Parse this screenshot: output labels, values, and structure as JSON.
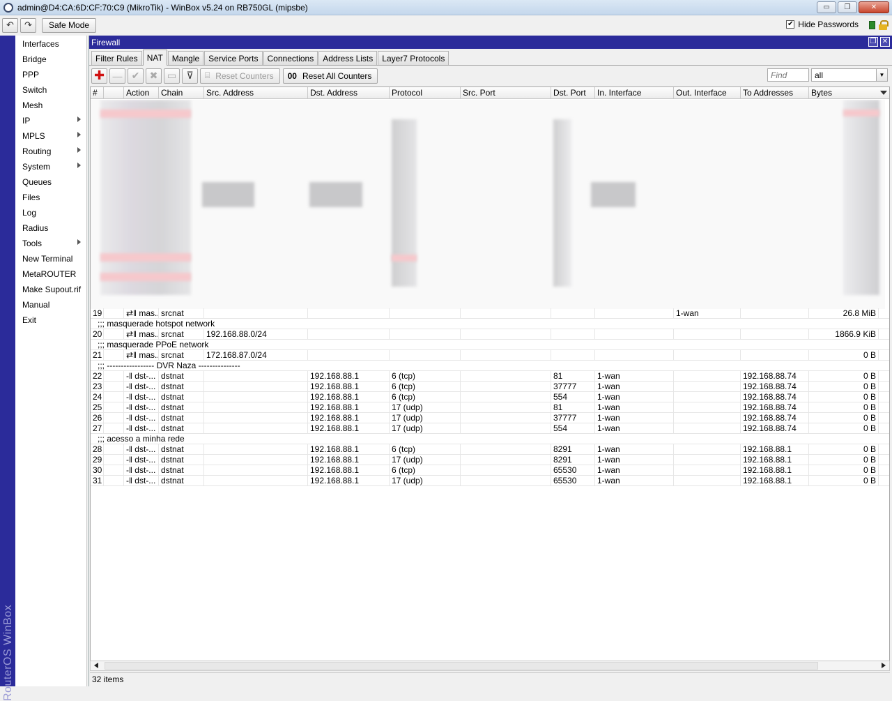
{
  "window": {
    "title": "admin@D4:CA:6D:CF:70:C9 (MikroTik) - WinBox v5.24 on RB750GL (mipsbe)",
    "controls": [
      "▭",
      "❐",
      "✕"
    ]
  },
  "toolbar": {
    "undo_icon": "↶",
    "redo_icon": "↷",
    "safe_mode_label": "Safe Mode",
    "hide_passwords_label": "Hide Passwords",
    "hide_passwords_checked": "✔"
  },
  "sidebar": {
    "brand": "RouterOS WinBox",
    "items": [
      {
        "label": "Interfaces"
      },
      {
        "label": "Bridge"
      },
      {
        "label": "PPP"
      },
      {
        "label": "Switch"
      },
      {
        "label": "Mesh"
      },
      {
        "label": "IP"
      },
      {
        "label": "MPLS"
      },
      {
        "label": "Routing"
      },
      {
        "label": "System"
      },
      {
        "label": "Queues"
      },
      {
        "label": "Files"
      },
      {
        "label": "Log"
      },
      {
        "label": "Radius"
      },
      {
        "label": "Tools"
      },
      {
        "label": "New Terminal"
      },
      {
        "label": "MetaROUTER"
      },
      {
        "label": "Make Supout.rif"
      },
      {
        "label": "Manual"
      },
      {
        "label": "Exit"
      }
    ]
  },
  "firewall": {
    "title": "Firewall",
    "tabs": [
      "Filter Rules",
      "NAT",
      "Mangle",
      "Service Ports",
      "Connections",
      "Address Lists",
      "Layer7 Protocols"
    ],
    "active_tab": "NAT",
    "buttons": {
      "add_icon": "✚",
      "remove_icon": "—",
      "enable_icon": "✔",
      "disable_icon": "✖",
      "comment_icon": "▭",
      "filter_icon": "⊽",
      "reset_counters": "Reset Counters",
      "reset_all_counters": "Reset All Counters",
      "reset_all_icon": "00"
    },
    "find_placeholder": "Find",
    "filter_value": "all",
    "columns": [
      "#",
      "",
      "Action",
      "Chain",
      "Src. Address",
      "Dst. Address",
      "Protocol",
      "Src. Port",
      "Dst. Port",
      "In. Interface",
      "Out. Interface",
      "To Addresses",
      "Bytes"
    ],
    "rows": [
      {
        "type": "rule",
        "num": "19",
        "action": "⇄‖ mas...",
        "chain": "srcnat",
        "src": "",
        "dst": "",
        "proto": "",
        "sport": "",
        "dport": "",
        "inif": "",
        "outif": "1-wan",
        "to": "",
        "bytes": "26.8 MiB"
      },
      {
        "type": "comment",
        "text": ";;; masquerade hotspot network"
      },
      {
        "type": "rule",
        "num": "20",
        "action": "⇄‖ mas...",
        "chain": "srcnat",
        "src": "192.168.88.0/24",
        "dst": "",
        "proto": "",
        "sport": "",
        "dport": "",
        "inif": "",
        "outif": "",
        "to": "",
        "bytes": "1866.9 KiB"
      },
      {
        "type": "comment",
        "text": ";;; masquerade PPoE network"
      },
      {
        "type": "rule",
        "num": "21",
        "action": "⇄‖ mas...",
        "chain": "srcnat",
        "src": "172.168.87.0/24",
        "dst": "",
        "proto": "",
        "sport": "",
        "dport": "",
        "inif": "",
        "outif": "",
        "to": "",
        "bytes": "0 B"
      },
      {
        "type": "comment",
        "text": ";;; ----------------- DVR Naza ---------------"
      },
      {
        "type": "rule",
        "num": "22",
        "action": "-‖ dst-...",
        "chain": "dstnat",
        "src": "",
        "dst": "192.168.88.1",
        "proto": "6 (tcp)",
        "sport": "",
        "dport": "81",
        "inif": "1-wan",
        "outif": "",
        "to": "192.168.88.74",
        "bytes": "0 B"
      },
      {
        "type": "rule",
        "num": "23",
        "action": "-‖ dst-...",
        "chain": "dstnat",
        "src": "",
        "dst": "192.168.88.1",
        "proto": "6 (tcp)",
        "sport": "",
        "dport": "37777",
        "inif": "1-wan",
        "outif": "",
        "to": "192.168.88.74",
        "bytes": "0 B"
      },
      {
        "type": "rule",
        "num": "24",
        "action": "-‖ dst-...",
        "chain": "dstnat",
        "src": "",
        "dst": "192.168.88.1",
        "proto": "6 (tcp)",
        "sport": "",
        "dport": "554",
        "inif": "1-wan",
        "outif": "",
        "to": "192.168.88.74",
        "bytes": "0 B"
      },
      {
        "type": "rule",
        "num": "25",
        "action": "-‖ dst-...",
        "chain": "dstnat",
        "src": "",
        "dst": "192.168.88.1",
        "proto": "17 (udp)",
        "sport": "",
        "dport": "81",
        "inif": "1-wan",
        "outif": "",
        "to": "192.168.88.74",
        "bytes": "0 B"
      },
      {
        "type": "rule",
        "num": "26",
        "action": "-‖ dst-...",
        "chain": "dstnat",
        "src": "",
        "dst": "192.168.88.1",
        "proto": "17 (udp)",
        "sport": "",
        "dport": "37777",
        "inif": "1-wan",
        "outif": "",
        "to": "192.168.88.74",
        "bytes": "0 B"
      },
      {
        "type": "rule",
        "num": "27",
        "action": "-‖ dst-...",
        "chain": "dstnat",
        "src": "",
        "dst": "192.168.88.1",
        "proto": "17 (udp)",
        "sport": "",
        "dport": "554",
        "inif": "1-wan",
        "outif": "",
        "to": "192.168.88.74",
        "bytes": "0 B"
      },
      {
        "type": "comment",
        "text": ";;; acesso a minha rede"
      },
      {
        "type": "rule",
        "num": "28",
        "action": "-‖ dst-...",
        "chain": "dstnat",
        "src": "",
        "dst": "192.168.88.1",
        "proto": "6 (tcp)",
        "sport": "",
        "dport": "8291",
        "inif": "1-wan",
        "outif": "",
        "to": "192.168.88.1",
        "bytes": "0 B"
      },
      {
        "type": "rule",
        "num": "29",
        "action": "-‖ dst-...",
        "chain": "dstnat",
        "src": "",
        "dst": "192.168.88.1",
        "proto": "17 (udp)",
        "sport": "",
        "dport": "8291",
        "inif": "1-wan",
        "outif": "",
        "to": "192.168.88.1",
        "bytes": "0 B"
      },
      {
        "type": "rule",
        "num": "30",
        "action": "-‖ dst-...",
        "chain": "dstnat",
        "src": "",
        "dst": "192.168.88.1",
        "proto": "6 (tcp)",
        "sport": "",
        "dport": "65530",
        "inif": "1-wan",
        "outif": "",
        "to": "192.168.88.1",
        "bytes": "0 B"
      },
      {
        "type": "rule",
        "num": "31",
        "action": "-‖ dst-...",
        "chain": "dstnat",
        "src": "",
        "dst": "192.168.88.1",
        "proto": "17 (udp)",
        "sport": "",
        "dport": "65530",
        "inif": "1-wan",
        "outif": "",
        "to": "192.168.88.1",
        "bytes": "0 B"
      }
    ],
    "status": "32 items"
  }
}
